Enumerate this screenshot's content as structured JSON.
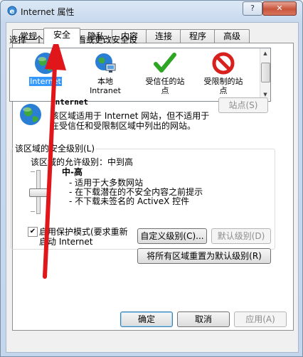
{
  "window": {
    "title": "Internet 属性",
    "help_label": "?",
    "close_label": "✕"
  },
  "tabs": [
    {
      "label": "常规"
    },
    {
      "label": "安全"
    },
    {
      "label": "隐私"
    },
    {
      "label": "内容"
    },
    {
      "label": "连接"
    },
    {
      "label": "程序"
    },
    {
      "label": "高级"
    }
  ],
  "security": {
    "zone_prompt": "选择一个区域以查看或更改安全设",
    "zones": [
      {
        "line1": "Internet",
        "line2": "",
        "icon": "globe-icon",
        "selected": true
      },
      {
        "line1": "本地",
        "line2": "Intranet",
        "icon": "intranet-globe-icon",
        "selected": false
      },
      {
        "line1": "受信任的站",
        "line2": "点",
        "icon": "green-check-icon",
        "selected": false
      },
      {
        "line1": "受限制的站",
        "line2": "点",
        "icon": "red-prohibit-icon",
        "selected": false
      }
    ],
    "sites_button": "站点(S)",
    "zone_title": "Internet",
    "zone_desc_line1": "该区域适用于 Internet 网站，但不适用于",
    "zone_desc_line2": "在受信任和受限制区域中列出的网站。",
    "level_group_title": "该区域的安全级别(L)",
    "allowed_levels": "该区域的允许级别：中到高",
    "level_name": "中-高",
    "level_items": [
      "- 适用于大多数网站",
      "- 在下载潜在的不安全内容之前提示",
      "- 不下载未签名的 ActiveX 控件"
    ],
    "protected_mode_line1": "启用保护模式(要求重新",
    "protected_mode_line2": "启动 Internet",
    "protected_mode_checked": true,
    "custom_level_button": "自定义级别(C)...",
    "default_level_button": "默认级别(D)",
    "reset_all_button": "将所有区域重置为默认级别(R)"
  },
  "footer": {
    "ok": "确定",
    "cancel": "取消",
    "apply": "应用(A)"
  },
  "colors": {
    "selection": "#3399ff",
    "annotation_arrow": "#e0161b"
  }
}
